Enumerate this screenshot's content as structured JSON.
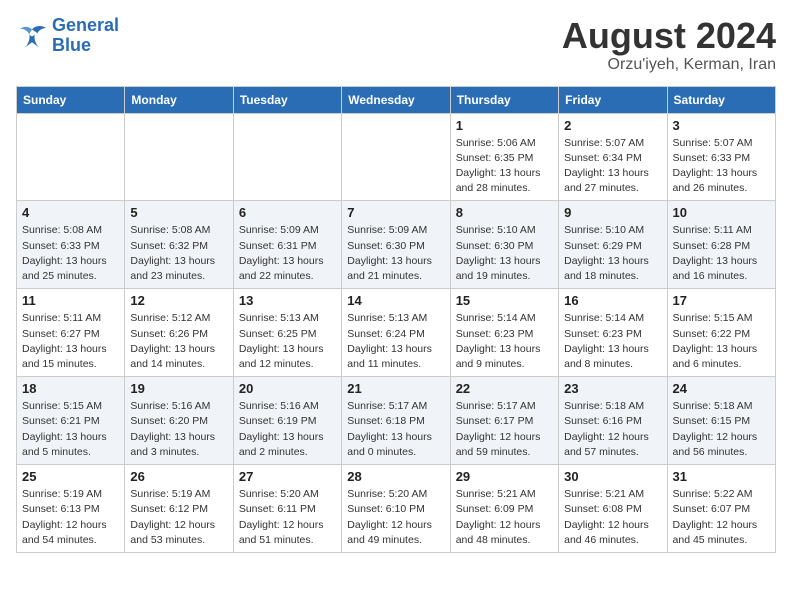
{
  "logo": {
    "line1": "General",
    "line2": "Blue"
  },
  "title": "August 2024",
  "subtitle": "Orzu'iyeh, Kerman, Iran",
  "weekdays": [
    "Sunday",
    "Monday",
    "Tuesday",
    "Wednesday",
    "Thursday",
    "Friday",
    "Saturday"
  ],
  "weeks": [
    [
      {
        "day": "",
        "content": ""
      },
      {
        "day": "",
        "content": ""
      },
      {
        "day": "",
        "content": ""
      },
      {
        "day": "",
        "content": ""
      },
      {
        "day": "1",
        "content": "Sunrise: 5:06 AM\nSunset: 6:35 PM\nDaylight: 13 hours\nand 28 minutes."
      },
      {
        "day": "2",
        "content": "Sunrise: 5:07 AM\nSunset: 6:34 PM\nDaylight: 13 hours\nand 27 minutes."
      },
      {
        "day": "3",
        "content": "Sunrise: 5:07 AM\nSunset: 6:33 PM\nDaylight: 13 hours\nand 26 minutes."
      }
    ],
    [
      {
        "day": "4",
        "content": "Sunrise: 5:08 AM\nSunset: 6:33 PM\nDaylight: 13 hours\nand 25 minutes."
      },
      {
        "day": "5",
        "content": "Sunrise: 5:08 AM\nSunset: 6:32 PM\nDaylight: 13 hours\nand 23 minutes."
      },
      {
        "day": "6",
        "content": "Sunrise: 5:09 AM\nSunset: 6:31 PM\nDaylight: 13 hours\nand 22 minutes."
      },
      {
        "day": "7",
        "content": "Sunrise: 5:09 AM\nSunset: 6:30 PM\nDaylight: 13 hours\nand 21 minutes."
      },
      {
        "day": "8",
        "content": "Sunrise: 5:10 AM\nSunset: 6:30 PM\nDaylight: 13 hours\nand 19 minutes."
      },
      {
        "day": "9",
        "content": "Sunrise: 5:10 AM\nSunset: 6:29 PM\nDaylight: 13 hours\nand 18 minutes."
      },
      {
        "day": "10",
        "content": "Sunrise: 5:11 AM\nSunset: 6:28 PM\nDaylight: 13 hours\nand 16 minutes."
      }
    ],
    [
      {
        "day": "11",
        "content": "Sunrise: 5:11 AM\nSunset: 6:27 PM\nDaylight: 13 hours\nand 15 minutes."
      },
      {
        "day": "12",
        "content": "Sunrise: 5:12 AM\nSunset: 6:26 PM\nDaylight: 13 hours\nand 14 minutes."
      },
      {
        "day": "13",
        "content": "Sunrise: 5:13 AM\nSunset: 6:25 PM\nDaylight: 13 hours\nand 12 minutes."
      },
      {
        "day": "14",
        "content": "Sunrise: 5:13 AM\nSunset: 6:24 PM\nDaylight: 13 hours\nand 11 minutes."
      },
      {
        "day": "15",
        "content": "Sunrise: 5:14 AM\nSunset: 6:23 PM\nDaylight: 13 hours\nand 9 minutes."
      },
      {
        "day": "16",
        "content": "Sunrise: 5:14 AM\nSunset: 6:23 PM\nDaylight: 13 hours\nand 8 minutes."
      },
      {
        "day": "17",
        "content": "Sunrise: 5:15 AM\nSunset: 6:22 PM\nDaylight: 13 hours\nand 6 minutes."
      }
    ],
    [
      {
        "day": "18",
        "content": "Sunrise: 5:15 AM\nSunset: 6:21 PM\nDaylight: 13 hours\nand 5 minutes."
      },
      {
        "day": "19",
        "content": "Sunrise: 5:16 AM\nSunset: 6:20 PM\nDaylight: 13 hours\nand 3 minutes."
      },
      {
        "day": "20",
        "content": "Sunrise: 5:16 AM\nSunset: 6:19 PM\nDaylight: 13 hours\nand 2 minutes."
      },
      {
        "day": "21",
        "content": "Sunrise: 5:17 AM\nSunset: 6:18 PM\nDaylight: 13 hours\nand 0 minutes."
      },
      {
        "day": "22",
        "content": "Sunrise: 5:17 AM\nSunset: 6:17 PM\nDaylight: 12 hours\nand 59 minutes."
      },
      {
        "day": "23",
        "content": "Sunrise: 5:18 AM\nSunset: 6:16 PM\nDaylight: 12 hours\nand 57 minutes."
      },
      {
        "day": "24",
        "content": "Sunrise: 5:18 AM\nSunset: 6:15 PM\nDaylight: 12 hours\nand 56 minutes."
      }
    ],
    [
      {
        "day": "25",
        "content": "Sunrise: 5:19 AM\nSunset: 6:13 PM\nDaylight: 12 hours\nand 54 minutes."
      },
      {
        "day": "26",
        "content": "Sunrise: 5:19 AM\nSunset: 6:12 PM\nDaylight: 12 hours\nand 53 minutes."
      },
      {
        "day": "27",
        "content": "Sunrise: 5:20 AM\nSunset: 6:11 PM\nDaylight: 12 hours\nand 51 minutes."
      },
      {
        "day": "28",
        "content": "Sunrise: 5:20 AM\nSunset: 6:10 PM\nDaylight: 12 hours\nand 49 minutes."
      },
      {
        "day": "29",
        "content": "Sunrise: 5:21 AM\nSunset: 6:09 PM\nDaylight: 12 hours\nand 48 minutes."
      },
      {
        "day": "30",
        "content": "Sunrise: 5:21 AM\nSunset: 6:08 PM\nDaylight: 12 hours\nand 46 minutes."
      },
      {
        "day": "31",
        "content": "Sunrise: 5:22 AM\nSunset: 6:07 PM\nDaylight: 12 hours\nand 45 minutes."
      }
    ]
  ]
}
